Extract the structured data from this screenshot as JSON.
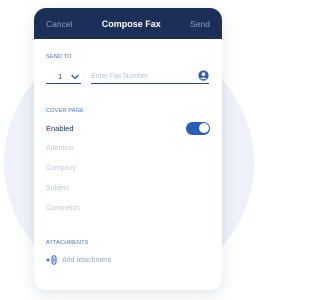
{
  "navbar": {
    "cancel_label": "Cancel",
    "title": "Compose Fax",
    "send_label": "Send"
  },
  "send_to": {
    "heading": "SEND TO",
    "country_code": "1",
    "fax_placeholder": "Enter Fax Number"
  },
  "cover_page": {
    "heading": "COVER PAGE",
    "enabled_label": "Enabled",
    "enabled": true,
    "fields": [
      "Attention",
      "Company",
      "Subject",
      "Comments"
    ]
  },
  "attachments": {
    "heading": "ATTACHMENTS",
    "add_label": "Add attachment"
  },
  "colors": {
    "navbar": "#1b2f58",
    "accent": "#3f6fc4",
    "toggle_on": "#2a5db8",
    "background_circle": "#eef1f9"
  },
  "icons": [
    "chevron-down-icon",
    "contact-icon",
    "paperclip-add-icon"
  ]
}
